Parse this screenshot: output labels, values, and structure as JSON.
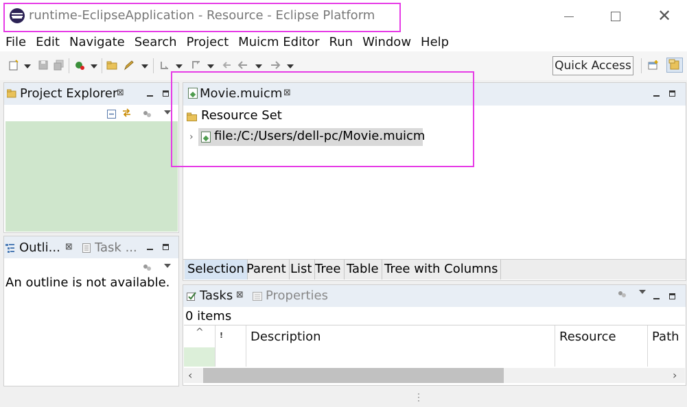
{
  "window": {
    "title": "runtime-EclipseApplication - Resource - Eclipse Platform",
    "close_glyph": "✕"
  },
  "menubar": {
    "items": [
      "File",
      "Edit",
      "Navigate",
      "Search",
      "Project",
      "Muicm Editor",
      "Run",
      "Window",
      "Help"
    ]
  },
  "toolbar": {
    "quick_access": "Quick Access"
  },
  "project_explorer": {
    "tab_label": "Project Explorer"
  },
  "outline": {
    "tab_label": "Outli...",
    "task_tab_label": "Task ...",
    "message": "An outline is not available."
  },
  "editor": {
    "tab_label": "Movie.muicm",
    "root_label": "Resource Set",
    "item_label": "file:/C:/Users/dell-pc/Movie.muicm",
    "bottom_tabs": [
      "Selection",
      "Parent",
      "List",
      "Tree",
      "Table",
      "Tree with Columns"
    ]
  },
  "tasks": {
    "tab_label": "Tasks",
    "properties_tab_label": "Properties",
    "count_text": "0 items",
    "priority_marker": "!",
    "columns": [
      "Description",
      "Resource",
      "Path"
    ]
  },
  "colors": {
    "highlight": "#e63be6",
    "explorer_body": "#cfe6cc",
    "tab_strip": "#e8eef5",
    "selected_tab": "#d6e4f3"
  }
}
